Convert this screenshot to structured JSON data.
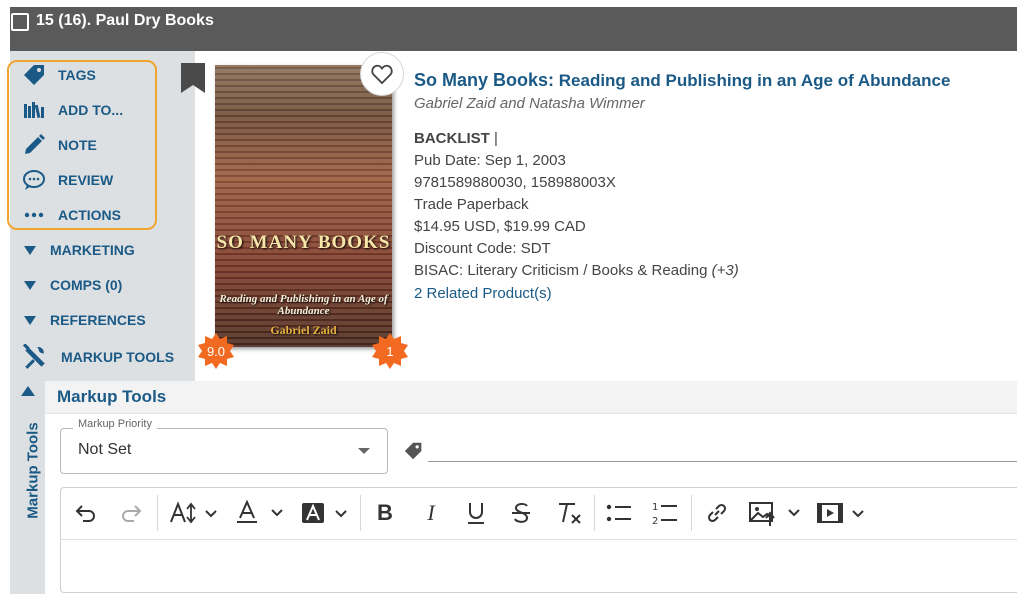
{
  "header": {
    "title": "15 (16). Paul Dry Books"
  },
  "sidebar": {
    "actions": [
      {
        "label": "TAGS",
        "icon": "tag-icon"
      },
      {
        "label": "ADD TO...",
        "icon": "shelf-icon"
      },
      {
        "label": "NOTE",
        "icon": "pencil-icon"
      },
      {
        "label": "REVIEW",
        "icon": "comment-icon"
      },
      {
        "label": "ACTIONS",
        "icon": "more-icon"
      }
    ],
    "sections": [
      {
        "label": "MARKETING"
      },
      {
        "label": "COMPS (0)"
      },
      {
        "label": "REFERENCES"
      }
    ],
    "markup_tools": "MARKUP TOOLS",
    "vertical_label": "Markup Tools"
  },
  "book": {
    "title_main": "So Many Books:",
    "title_sub": " Reading and Publishing in an Age of Abundance",
    "authors": "Gabriel Zaid and Natasha Wimmer",
    "status": "BACKLIST",
    "status_sep": " |",
    "pub_date": "Pub Date: Sep 1, 2003",
    "isbns": "9781589880030, 158988003X",
    "format": "Trade Paperback",
    "price": "$14.95 USD, $19.99 CAD",
    "discount": "Discount Code: SDT",
    "bisac": "BISAC: Literary Criticism / Books & Reading",
    "bisac_more": "(+3)",
    "related": "2 Related Product(s)"
  },
  "cover": {
    "title": "SO MANY BOOKS",
    "subtitle": "Reading and Publishing in an Age of Abundance",
    "author": "Gabriel Zaid",
    "badge_left": "9.0",
    "badge_right": "1"
  },
  "markup_panel": {
    "title": "Markup Tools",
    "priority_label": "Markup Priority",
    "priority_value": "Not Set"
  },
  "colors": {
    "accent": "#1b5a86",
    "highlight": "#f0a530",
    "badge": "#f26a21",
    "header": "#5a5a5a"
  }
}
